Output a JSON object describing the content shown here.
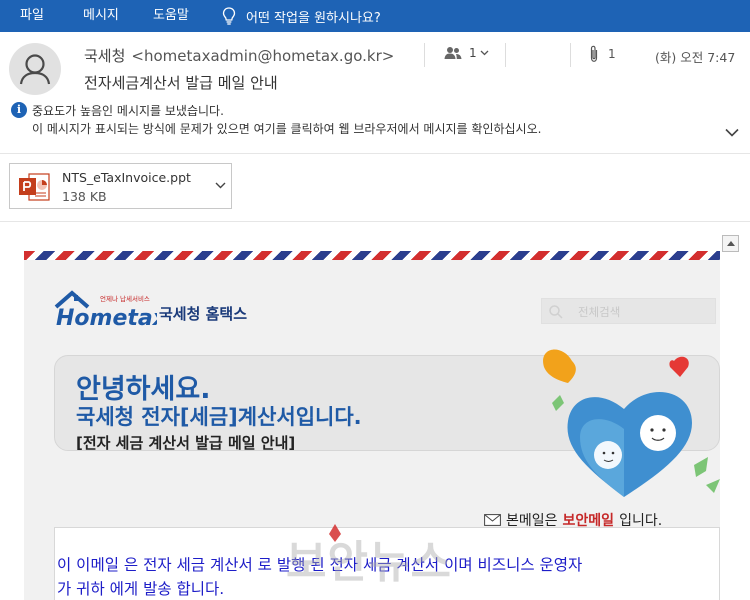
{
  "ribbon": {
    "tabs": [
      "파일",
      "메시지",
      "도움말"
    ],
    "tell_me": "어떤 작업을 원하시나요?"
  },
  "header": {
    "sender_name": "국세청",
    "sender_email": "<hometaxadmin@hometax.go.kr>",
    "subject": "전자세금계산서 발급 메일 안내",
    "people_count": "1",
    "attachment_count": "1",
    "datetime": "(화) 오전 7:47",
    "info_line1": "중요도가 높음인 메시지를 보냈습니다.",
    "info_line2": "이 메시지가 표시되는 방식에 문제가 있으면 여기를 클릭하여 웹 브라우저에서 메시지를 확인하십시오."
  },
  "attachment": {
    "filename": "NTS_eTaxInvoice.ppt",
    "size": "138 KB"
  },
  "mail_body": {
    "logo_tagline": "언제나 납세서비스",
    "logo_text": "Hometax",
    "brand_text": "국세청 홈택스",
    "search_placeholder": "전체검색",
    "greeting": "안녕하세요.",
    "title": "국세청 전자[세금]계산서입니다.",
    "subtitle": "[전자 세금 계산서 발급 메일 안내]",
    "secure_prefix": "본메일은",
    "secure_highlight": "보안메일",
    "secure_suffix": "입니다.",
    "notice_line1": "이 이메일 은 전자 세금 계산서 로 발행 된 전자 세금 계산서 이며 비즈니스 운영자",
    "notice_line2": "가 귀하 에게 발송 합니다."
  },
  "watermark": "보안뉴스",
  "colors": {
    "ribbon": "#1e63b5",
    "heading_blue": "#1f5aa6",
    "notice_blue": "#1d1dc8",
    "secure_red": "#c62828"
  }
}
